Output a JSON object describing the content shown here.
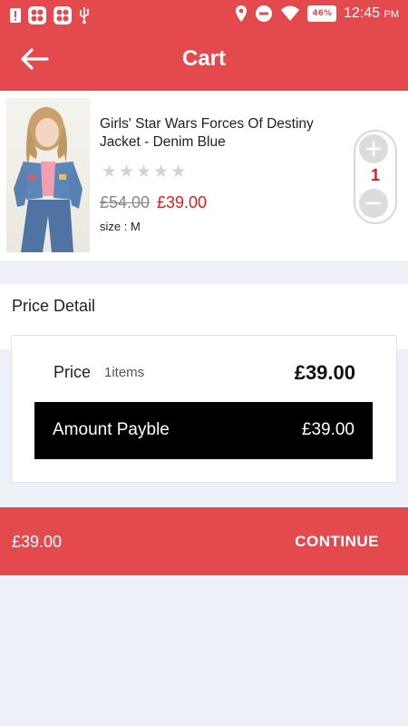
{
  "status_bar": {
    "time": "12:45",
    "ampm": "PM",
    "battery": "46%",
    "left_icons": [
      "alert-icon",
      "app-icon",
      "app-icon",
      "usb-icon"
    ],
    "right_icons": [
      "location-icon",
      "do-not-disturb-icon",
      "wifi-icon",
      "battery-icon"
    ]
  },
  "app_bar": {
    "title": "Cart",
    "back_icon": "arrow-left-icon",
    "color": "#e44a4d"
  },
  "cart_item": {
    "name": "Girls' Star Wars Forces Of Destiny Jacket - Denim Blue",
    "rating_stars": 5,
    "rating_filled": 0,
    "old_price": "£54.00",
    "price": "£39.00",
    "size": "size : M",
    "quantity": "1",
    "plus_icon": "plus-circle-icon",
    "minus_icon": "minus-circle-icon"
  },
  "price_detail": {
    "title": "Price Detail",
    "price_label": "Price",
    "items_count": "1items",
    "price_value": "£39.00",
    "amount_label": "Amount Payble",
    "amount_value": "£39.00"
  },
  "footer": {
    "total": "£39.00",
    "continue_label": "CONTINUE"
  },
  "colors": {
    "accent": "#e44a4d",
    "price_red": "#e21c1c",
    "amount_bg": "#000000",
    "page_bg": "#eef0f7"
  }
}
